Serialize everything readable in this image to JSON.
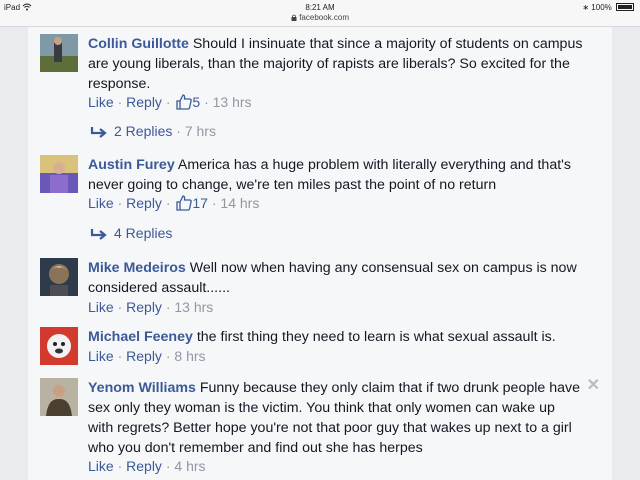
{
  "status_bar": {
    "device": "iPad",
    "time": "8:21 AM",
    "url": "facebook.com",
    "battery": "100%"
  },
  "actions": {
    "like": "Like",
    "reply": "Reply",
    "dot": "·"
  },
  "comments": [
    {
      "author": "Collin Guillotte",
      "text": "Should I insinuate that since a majority of students on campus are young liberals, than the majority of rapists are liberals? So excited for the response.",
      "likes": "5",
      "time": "13 hrs",
      "replies_label": "2 Replies",
      "replies_time": "7 hrs"
    },
    {
      "author": "Austin Furey",
      "text": "America has a huge problem with literally everything and that's never going to change, we're ten miles past the point of no return",
      "likes": "17",
      "time": "14 hrs",
      "replies_label": "4 Replies"
    },
    {
      "author": "Mike Medeiros",
      "text": "Well now when having any consensual sex on campus is now considered assault......",
      "time": "13 hrs"
    },
    {
      "author": "Michael Feeney",
      "text": "the first thing they need to learn is what sexual assault is.",
      "time": "8 hrs"
    },
    {
      "author": "Yenom Williams",
      "text": "Funny because they only claim that if two drunk people have sex only they woman is the victim. You think that only women can wake up with regrets? Better hope you're not that poor guy that wakes up next to a girl who you don't remember and find out she has herpes",
      "time": "4 hrs"
    }
  ],
  "colors": {
    "link": "#3b5998",
    "meta": "#9197a3",
    "background": "#f6f7f9"
  },
  "icons": [
    "wifi-icon",
    "lock-icon",
    "bluetooth-icon",
    "battery-icon",
    "thumbs-up-icon",
    "reply-arrow-icon",
    "close-icon"
  ]
}
